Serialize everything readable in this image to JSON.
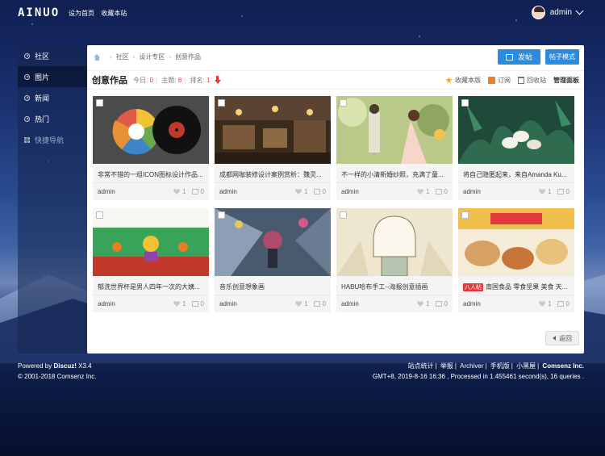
{
  "topbar": {
    "logo": "AINUO",
    "links": [
      "设为首页",
      "收藏本站"
    ],
    "username": "admin"
  },
  "sidebar": {
    "items": [
      {
        "label": "社区",
        "active": false
      },
      {
        "label": "图片",
        "active": true
      },
      {
        "label": "新闻",
        "active": false
      },
      {
        "label": "热门",
        "active": false
      },
      {
        "label": "快捷导航",
        "active": false
      }
    ]
  },
  "breadcrumb": [
    "社区",
    "设计专区",
    "创意作品"
  ],
  "buttons": {
    "post": "发帖",
    "mode": "帖子模式",
    "back": "返回"
  },
  "forum": {
    "title": "创意作品",
    "today_label": "今日:",
    "today": "0",
    "topics_label": "主题:",
    "topics": "8",
    "rank_label": "排名:",
    "rank": "1"
  },
  "tools": {
    "favorite": "收藏本版",
    "subscribe": "订阅",
    "recycle": "回收站",
    "manage": "管理面板"
  },
  "cards": [
    {
      "title": "非常不错的一组ICON图标设计作品...",
      "author": "admin",
      "likes": "1",
      "replies": "0"
    },
    {
      "title": "成都网咖装修设计案例赏析：魏灵...",
      "author": "admin",
      "likes": "1",
      "replies": "0"
    },
    {
      "title": "不一样的小清新婚纱照，充满了童...",
      "author": "admin",
      "likes": "1",
      "replies": "0"
    },
    {
      "title": "将自己隐匿起来，来自Amanda Ku...",
      "author": "admin",
      "likes": "1",
      "replies": "0"
    },
    {
      "title": "郁洗世界杯是男人四年一次的大姨...",
      "author": "admin",
      "likes": "1",
      "replies": "0"
    },
    {
      "title": "音乐创意想象画",
      "author": "admin",
      "likes": "1",
      "replies": "0"
    },
    {
      "title": "HABU哈布手工--海报创意插画",
      "author": "admin",
      "likes": "1",
      "replies": "0"
    },
    {
      "title": "南国食品 零食坚果 美食 天...",
      "author": "admin",
      "likes": "1",
      "replies": "0",
      "tag": "八人帖"
    }
  ],
  "footer": {
    "powered": "Powered by",
    "brand": "Discuz!",
    "version": "X3.4",
    "copyright": "© 2001-2018 Comsenz Inc.",
    "links": [
      "站点统计",
      "举报",
      "Archiver",
      "手机版",
      "小黑屋"
    ],
    "company": "Comsenz Inc.",
    "stats": "GMT+8, 2019-8-16 16:36 , Processed in 1.455461 second(s), 16 queries ."
  }
}
